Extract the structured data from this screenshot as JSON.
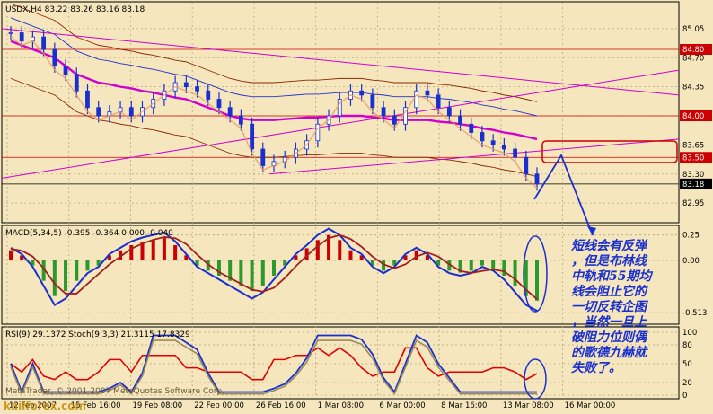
{
  "chart_data": [
    {
      "type": "candlestick",
      "title": "USDX,H4  83.22 83.26 83.16 83.18",
      "ylim": [
        82.8,
        85.2
      ],
      "y_ticks": [
        "85.05",
        "84.70",
        "84.35",
        "84.00",
        "83.65",
        "83.30",
        "82.95"
      ],
      "price_markers": [
        {
          "label": "84.80",
          "color": "#cc0000"
        },
        {
          "label": "84.00",
          "color": "#cc0000"
        },
        {
          "label": "83.50",
          "color": "#cc0000"
        },
        {
          "label": "83.18",
          "color": "#000000"
        }
      ],
      "series": [
        {
          "name": "close",
          "values": [
            85.0,
            84.9,
            84.95,
            84.8,
            84.6,
            84.5,
            84.3,
            84.1,
            84.0,
            84.05,
            84.1,
            84.0,
            84.1,
            84.2,
            84.3,
            84.4,
            84.35,
            84.3,
            84.2,
            84.1,
            84.0,
            83.9,
            83.6,
            83.4,
            83.45,
            83.5,
            83.6,
            83.7,
            83.9,
            84.0,
            84.2,
            84.3,
            84.25,
            84.1,
            84.0,
            83.9,
            84.1,
            84.3,
            84.25,
            84.1,
            84.0,
            83.9,
            83.8,
            83.7,
            83.65,
            83.6,
            83.5,
            83.3,
            83.18
          ]
        },
        {
          "name": "ma_magenta",
          "values": [
            84.9,
            84.85,
            84.8,
            84.75,
            84.7,
            84.6,
            84.5,
            84.45,
            84.4,
            84.38,
            84.35,
            84.33,
            84.3,
            84.28,
            84.25,
            84.22,
            84.2,
            84.15,
            84.1,
            84.05,
            84.0,
            83.97,
            83.95,
            83.95,
            83.95,
            83.96,
            83.97,
            83.98,
            83.98,
            83.99,
            84.0,
            84.0,
            84.0,
            83.98,
            83.97,
            83.95,
            83.95,
            83.95,
            83.95,
            83.93,
            83.92,
            83.9,
            83.88,
            83.85,
            83.83,
            83.8,
            83.78,
            83.75,
            83.72
          ]
        }
      ]
    },
    {
      "type": "histogram-line",
      "title": "MACD(5,34,5) -0.395 -0.364 0.000 -0.040",
      "y_ticks": [
        "0.25",
        "0.00",
        "-0.513"
      ],
      "histogram": [
        0.1,
        0.05,
        -0.05,
        -0.2,
        -0.35,
        -0.3,
        -0.2,
        -0.1,
        -0.05,
        0.05,
        0.1,
        0.15,
        0.18,
        0.2,
        0.22,
        0.15,
        0.05,
        -0.05,
        -0.1,
        -0.15,
        -0.2,
        -0.25,
        -0.3,
        -0.25,
        -0.15,
        -0.05,
        0.05,
        0.12,
        0.2,
        0.25,
        0.2,
        0.1,
        0.05,
        -0.05,
        -0.1,
        -0.05,
        0.05,
        0.1,
        0.05,
        -0.05,
        -0.1,
        -0.12,
        -0.1,
        -0.05,
        -0.08,
        -0.15,
        -0.25,
        -0.35,
        -0.395
      ]
    },
    {
      "type": "line",
      "title": "RSI(9) 29.1372  Stoch(9,3,3) 21.3115 17.8329",
      "y_ticks": [
        "100",
        "80",
        "50",
        "20",
        "0"
      ]
    }
  ],
  "x_ticks": [
    "12 Feb 2007",
    "15 Feb 16:00",
    "19 Feb 08:00",
    "22 Feb 00:00",
    "26 Feb 16:00",
    "1 Mar 08:00",
    "6 Mar 00:00",
    "8 Mar 16:00",
    "13 Mar 08:00",
    "16 Mar 00:00"
  ],
  "annotation_lines": [
    "短线会有反弹",
    "，但是布林线",
    "中轨和55期均",
    "线会阻止它的",
    "一切反转企图",
    "，当然一旦上",
    "破阻力位则偶",
    "的歌德九赫就",
    "失败了。"
  ],
  "copyright": "MetaTrader, © 2001-2007 MetaQuotes Software Corp.",
  "watermark": "kailforex.com",
  "colors": {
    "background": "#f5e6bd",
    "grid": "#b8a77a",
    "macd_line": "#1a2fd0",
    "signal_line": "#a02020",
    "hist_up": "#cc0000",
    "hist_down": "#2a9a2a",
    "ma": "#d000d0"
  }
}
